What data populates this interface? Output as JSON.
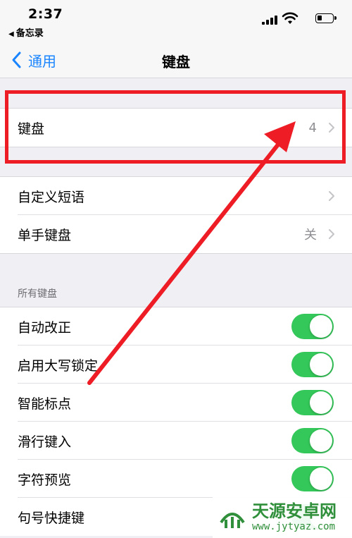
{
  "status_bar": {
    "time": "2:37",
    "back_app": "备忘录",
    "icons": [
      "cellular-signal-icon",
      "wifi-icon",
      "battery-icon"
    ]
  },
  "nav": {
    "back_label": "通用",
    "title": "键盘"
  },
  "group1": {
    "keyboards": {
      "label": "键盘",
      "value": "4"
    }
  },
  "group2": {
    "items": [
      {
        "label": "自定义短语",
        "value": ""
      },
      {
        "label": "单手键盘",
        "value": "关"
      }
    ]
  },
  "all_keyboards": {
    "header": "所有键盘",
    "toggles": [
      {
        "label": "自动改正",
        "on": true
      },
      {
        "label": "启用大写锁定",
        "on": true
      },
      {
        "label": "智能标点",
        "on": true
      },
      {
        "label": "滑行键入",
        "on": true
      },
      {
        "label": "字符预览",
        "on": true
      },
      {
        "label": "句号快捷键",
        "on": true
      }
    ]
  },
  "annotation": {
    "highlight_color": "#ee1c25",
    "accent_color": "#1a84ff",
    "toggle_color": "#34c759"
  },
  "watermark": {
    "title": "天源安卓网",
    "url": "www.jytyaz.com"
  }
}
